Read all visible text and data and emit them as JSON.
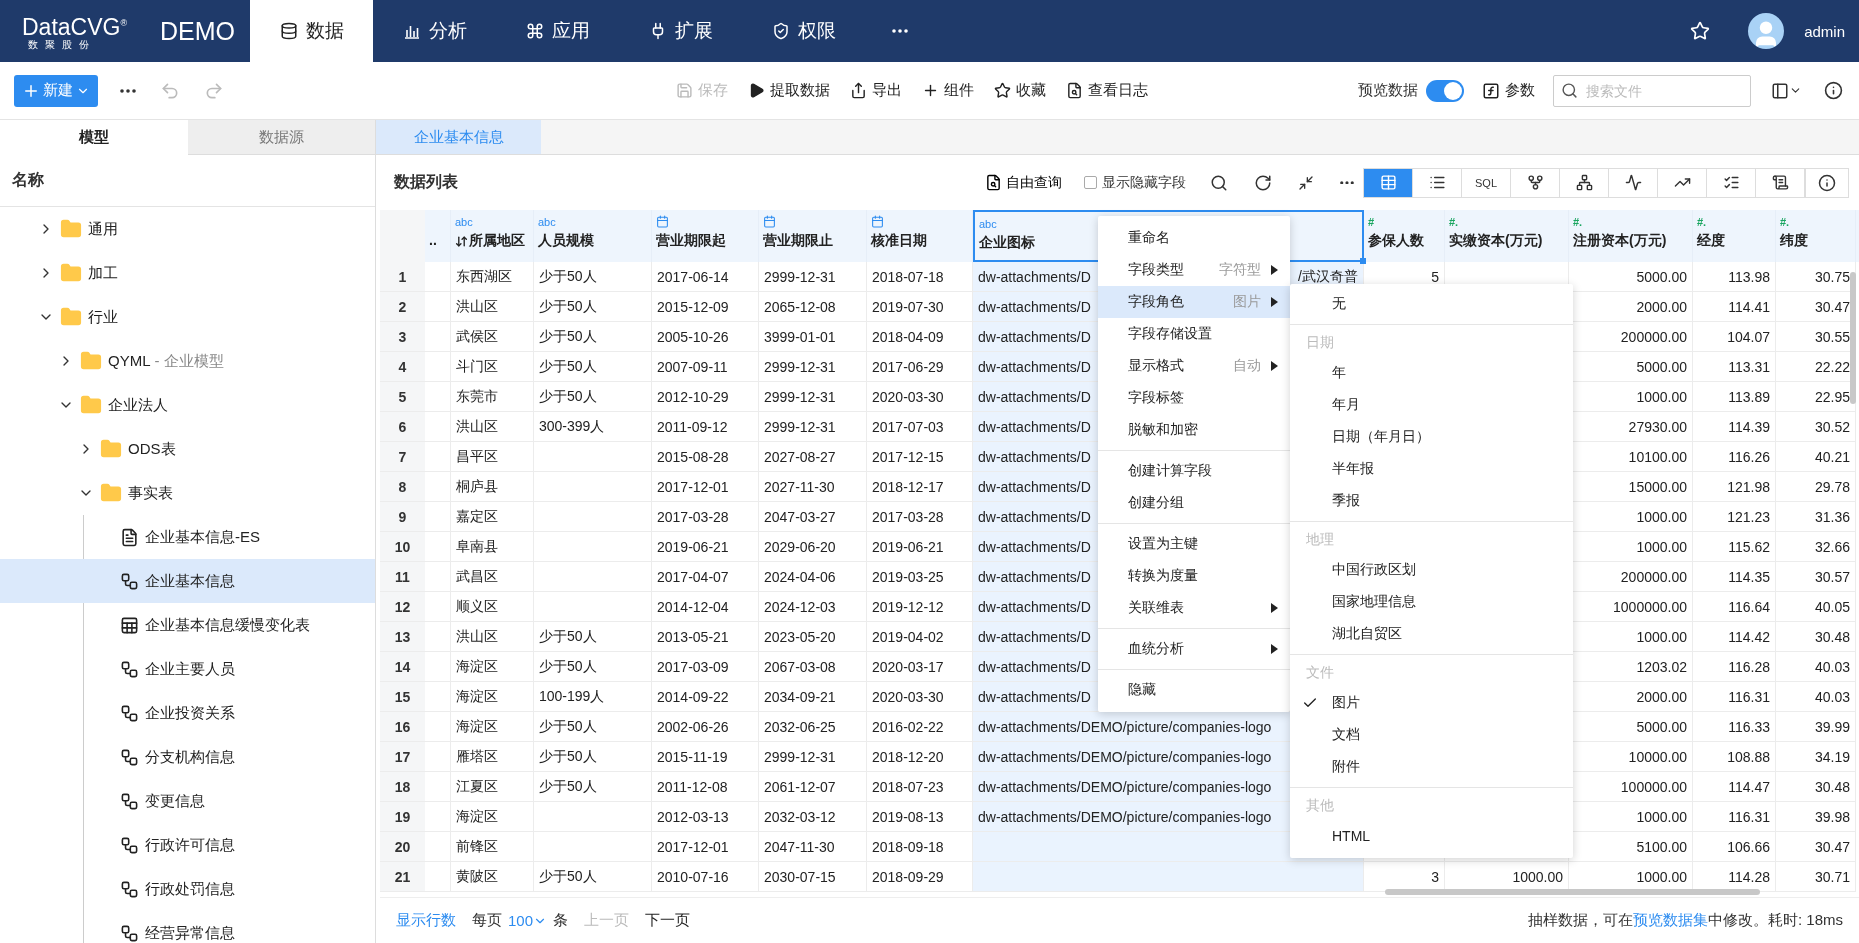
{
  "nav": {
    "logo": "DataCVG",
    "logo_mark": "®",
    "logo_sub": "数聚股份",
    "workspace": "DEMO",
    "tabs": [
      {
        "label": "数据",
        "selected": true
      },
      {
        "label": "分析",
        "selected": false
      },
      {
        "label": "应用",
        "selected": false
      },
      {
        "label": "扩展",
        "selected": false
      },
      {
        "label": "权限",
        "selected": false
      }
    ],
    "user": "admin"
  },
  "toolbar": {
    "new": "新建",
    "actions": [
      {
        "label": "保存",
        "disabled": true
      },
      {
        "label": "提取数据",
        "disabled": false
      },
      {
        "label": "导出",
        "disabled": false
      },
      {
        "label": "组件",
        "disabled": false
      },
      {
        "label": "收藏",
        "disabled": false
      },
      {
        "label": "查看日志",
        "disabled": false
      }
    ],
    "preview": {
      "label": "预览数据",
      "on": true
    },
    "params": "参数",
    "search": {
      "placeholder": "搜索文件"
    }
  },
  "sidebar": {
    "tabs": [
      {
        "label": "模型",
        "selected": true
      },
      {
        "label": "数据源",
        "selected": false
      }
    ],
    "header": "名称",
    "tree": [
      {
        "name": "通用",
        "kind": "folder",
        "expanded": false,
        "selected": false
      },
      {
        "name": "加工",
        "kind": "folder",
        "expanded": false,
        "selected": false
      },
      {
        "name": "行业",
        "kind": "folder",
        "expanded": true,
        "selected": false,
        "children": [
          {
            "name": "QYML",
            "alias": "- 企业模型",
            "kind": "folder",
            "expanded": false,
            "selected": false
          },
          {
            "name": "企业法人",
            "kind": "folder",
            "expanded": true,
            "selected": false,
            "children": [
              {
                "name": "ODS表",
                "kind": "folder",
                "expanded": false,
                "selected": false
              },
              {
                "name": "事实表",
                "kind": "folder",
                "expanded": true,
                "selected": false,
                "children": [
                  {
                    "name": "企业基本信息-ES",
                    "kind": "es",
                    "selected": false
                  },
                  {
                    "name": "企业基本信息",
                    "kind": "model",
                    "selected": true
                  },
                  {
                    "name": "企业基本信息缓慢变化表",
                    "kind": "table",
                    "selected": false
                  },
                  {
                    "name": "企业主要人员",
                    "kind": "model",
                    "selected": false
                  },
                  {
                    "name": "企业投资关系",
                    "kind": "model",
                    "selected": false
                  },
                  {
                    "name": "分支机构信息",
                    "kind": "model",
                    "selected": false
                  },
                  {
                    "name": "变更信息",
                    "kind": "model",
                    "selected": false
                  },
                  {
                    "name": "行政许可信息",
                    "kind": "model",
                    "selected": false
                  },
                  {
                    "name": "行政处罚信息",
                    "kind": "model",
                    "selected": false
                  },
                  {
                    "name": "经营异常信息",
                    "kind": "model",
                    "selected": false
                  }
                ]
              }
            ]
          }
        ]
      }
    ]
  },
  "main": {
    "tabs": [
      {
        "label": "企业基本信息",
        "selected": true
      }
    ],
    "title": "数据列表",
    "query": "自由查询",
    "show_hidden": {
      "label": "显示隐藏字段",
      "checked": false
    },
    "views": [
      {
        "selected": true
      },
      {
        "selected": false
      },
      {
        "label": "SQL",
        "selected": false
      },
      {
        "selected": false
      },
      {
        "selected": false
      },
      {
        "selected": false
      },
      {
        "selected": false
      },
      {
        "selected": false
      },
      {
        "selected": false
      }
    ]
  },
  "table": {
    "columns": [
      {
        "label": "..",
        "kind": "none",
        "selected": false,
        "sorted": false
      },
      {
        "label": "所属地区",
        "kind": "text",
        "tag": "abc",
        "selected": false,
        "sorted": true
      },
      {
        "label": "人员规模",
        "kind": "text",
        "tag": "abc",
        "selected": false,
        "sorted": false
      },
      {
        "label": "营业期限起",
        "kind": "date",
        "selected": false,
        "sorted": false
      },
      {
        "label": "营业期限止",
        "kind": "date",
        "selected": false,
        "sorted": false
      },
      {
        "label": "核准日期",
        "kind": "date",
        "selected": false,
        "sorted": false
      },
      {
        "label": "企业图标",
        "kind": "text",
        "tag": "abc",
        "selected": true,
        "sorted": false
      },
      {
        "label": "参保人数",
        "kind": "number",
        "tag": "#",
        "selected": false,
        "sorted": false
      },
      {
        "label": "实缴资本(万元)",
        "kind": "number",
        "tag": "#.",
        "selected": false,
        "sorted": false
      },
      {
        "label": "注册资本(万元)",
        "kind": "number",
        "tag": "#.",
        "selected": false,
        "sorted": false
      },
      {
        "label": "经度",
        "kind": "number",
        "tag": "#.",
        "selected": false,
        "sorted": false
      },
      {
        "label": "纬度",
        "kind": "number",
        "tag": "#.",
        "selected": false,
        "sorted": false
      }
    ],
    "rows": [
      {
        "no": "1",
        "cells": [
          null,
          "东西湖区",
          "少于50人",
          "2017-06-14",
          "2999-12-31",
          "2018-07-18",
          "dw-attachments/D",
          "5",
          null,
          "5000.00",
          "113.98",
          "30.75"
        ],
        "overflow": "/武汉奇普"
      },
      {
        "no": "2",
        "cells": [
          null,
          "洪山区",
          "少于50人",
          "2015-12-09",
          "2065-12-08",
          "2019-07-30",
          "dw-attachments/D",
          null,
          null,
          "2000.00",
          "114.41",
          "30.47"
        ]
      },
      {
        "no": "3",
        "cells": [
          null,
          "武侯区",
          "少于50人",
          "2005-10-26",
          "3999-01-01",
          "2018-04-09",
          "dw-attachments/D",
          null,
          null,
          "200000.00",
          "104.07",
          "30.55"
        ]
      },
      {
        "no": "4",
        "cells": [
          null,
          "斗门区",
          "少于50人",
          "2007-09-11",
          "2999-12-31",
          "2017-06-29",
          "dw-attachments/D",
          null,
          null,
          "5000.00",
          "113.31",
          "22.22"
        ]
      },
      {
        "no": "5",
        "cells": [
          null,
          "东莞市",
          "少于50人",
          "2012-10-29",
          "2999-12-31",
          "2020-03-30",
          "dw-attachments/D",
          null,
          null,
          "1000.00",
          "113.89",
          "22.95"
        ]
      },
      {
        "no": "6",
        "cells": [
          null,
          "洪山区",
          "300-399人",
          "2011-09-12",
          "2999-12-31",
          "2017-07-03",
          "dw-attachments/D",
          null,
          null,
          "27930.00",
          "114.39",
          "30.52"
        ]
      },
      {
        "no": "7",
        "cells": [
          null,
          "昌平区",
          null,
          "2015-08-28",
          "2027-08-27",
          "2017-12-15",
          "dw-attachments/D",
          null,
          null,
          "10100.00",
          "116.26",
          "40.21"
        ]
      },
      {
        "no": "8",
        "cells": [
          null,
          "桐庐县",
          null,
          "2017-12-01",
          "2027-11-30",
          "2018-12-17",
          "dw-attachments/D",
          null,
          null,
          "15000.00",
          "121.98",
          "29.78"
        ]
      },
      {
        "no": "9",
        "cells": [
          null,
          "嘉定区",
          null,
          "2017-03-28",
          "2047-03-27",
          "2017-03-28",
          "dw-attachments/D",
          null,
          null,
          "1000.00",
          "121.23",
          "31.36"
        ]
      },
      {
        "no": "10",
        "cells": [
          null,
          "阜南县",
          null,
          "2019-06-21",
          "2029-06-20",
          "2019-06-21",
          "dw-attachments/D",
          null,
          null,
          "1000.00",
          "115.62",
          "32.66"
        ]
      },
      {
        "no": "11",
        "cells": [
          null,
          "武昌区",
          null,
          "2017-04-07",
          "2024-04-06",
          "2019-03-25",
          "dw-attachments/D",
          null,
          null,
          "200000.00",
          "114.35",
          "30.57"
        ]
      },
      {
        "no": "12",
        "cells": [
          null,
          "顺义区",
          null,
          "2014-12-04",
          "2024-12-03",
          "2019-12-12",
          "dw-attachments/D",
          null,
          null,
          "1000000.00",
          "116.64",
          "40.05"
        ]
      },
      {
        "no": "13",
        "cells": [
          null,
          "洪山区",
          "少于50人",
          "2013-05-21",
          "2023-05-20",
          "2019-04-02",
          "dw-attachments/D",
          null,
          null,
          "1000.00",
          "114.42",
          "30.48"
        ]
      },
      {
        "no": "14",
        "cells": [
          null,
          "海淀区",
          "少于50人",
          "2017-03-09",
          "2067-03-08",
          "2020-03-17",
          "dw-attachments/D",
          null,
          null,
          "1203.02",
          "116.28",
          "40.03"
        ]
      },
      {
        "no": "15",
        "cells": [
          null,
          "海淀区",
          "100-199人",
          "2014-09-22",
          "2034-09-21",
          "2020-03-30",
          "dw-attachments/D",
          null,
          null,
          "2000.00",
          "116.31",
          "40.03"
        ]
      },
      {
        "no": "16",
        "cells": [
          null,
          "海淀区",
          "少于50人",
          "2002-06-26",
          "2032-06-25",
          "2016-02-22",
          "dw-attachments/DEMO/picture/companies-logo",
          null,
          null,
          "5000.00",
          "116.33",
          "39.99"
        ]
      },
      {
        "no": "17",
        "cells": [
          null,
          "雁塔区",
          "少于50人",
          "2015-11-19",
          "2999-12-31",
          "2018-12-20",
          "dw-attachments/DEMO/picture/companies-logo",
          null,
          null,
          "10000.00",
          "108.88",
          "34.19"
        ]
      },
      {
        "no": "18",
        "cells": [
          null,
          "江夏区",
          "少于50人",
          "2011-12-08",
          "2061-12-07",
          "2018-07-23",
          "dw-attachments/DEMO/picture/companies-logo",
          null,
          null,
          "100000.00",
          "114.47",
          "30.48"
        ]
      },
      {
        "no": "19",
        "cells": [
          null,
          "海淀区",
          null,
          "2012-03-13",
          "2032-03-12",
          "2019-08-13",
          "dw-attachments/DEMO/picture/companies-logo",
          null,
          null,
          "1000.00",
          "116.31",
          "39.98"
        ]
      },
      {
        "no": "20",
        "cells": [
          null,
          "前锋区",
          null,
          "2017-12-01",
          "2047-11-30",
          "2018-09-18",
          null,
          null,
          null,
          "5100.00",
          "106.66",
          "30.47"
        ]
      },
      {
        "no": "21",
        "cells": [
          null,
          "黄陂区",
          "少于50人",
          "2010-07-16",
          "2030-07-15",
          "2018-09-29",
          null,
          "3",
          "1000.00",
          "1000.00",
          "114.28",
          "30.71"
        ]
      }
    ]
  },
  "footer": {
    "rows_link": "显示行数",
    "per_page": "每页",
    "page_size": "100",
    "unit": "条",
    "prev": {
      "label": "上一页",
      "disabled": true
    },
    "next": {
      "label": "下一页",
      "disabled": false
    },
    "note": {
      "before": "抽样数据，可在",
      "link": "预览数据集",
      "after": "中修改。耗时: 18ms"
    }
  },
  "menu": {
    "groups": [
      [
        {
          "label": "重命名",
          "submenu": false,
          "highlighted": false
        },
        {
          "label": "字段类型",
          "value": "字符型",
          "submenu": true,
          "highlighted": false
        },
        {
          "label": "字段角色",
          "value": "图片",
          "submenu": true,
          "highlighted": true
        },
        {
          "label": "字段存储设置",
          "submenu": false,
          "highlighted": false
        },
        {
          "label": "显示格式",
          "value": "自动",
          "submenu": true,
          "highlighted": false
        },
        {
          "label": "字段标签",
          "submenu": false,
          "highlighted": false
        },
        {
          "label": "脱敏和加密",
          "submenu": false,
          "highlighted": false
        }
      ],
      [
        {
          "label": "创建计算字段",
          "submenu": false,
          "highlighted": false
        },
        {
          "label": "创建分组",
          "submenu": false,
          "highlighted": false
        }
      ],
      [
        {
          "label": "设置为主键",
          "submenu": false,
          "highlighted": false
        },
        {
          "label": "转换为度量",
          "submenu": false,
          "highlighted": false
        },
        {
          "label": "关联维表",
          "submenu": true,
          "highlighted": false
        }
      ],
      [
        {
          "label": "血统分析",
          "submenu": true,
          "highlighted": false
        }
      ],
      [
        {
          "label": "隐藏",
          "submenu": false,
          "highlighted": false
        }
      ]
    ]
  },
  "submenu": {
    "sections": [
      {
        "items": [
          {
            "label": "无",
            "checked": false
          }
        ]
      },
      {
        "title": "日期",
        "items": [
          {
            "label": "年",
            "checked": false
          },
          {
            "label": "年月",
            "checked": false
          },
          {
            "label": "日期（年月日）",
            "checked": false
          },
          {
            "label": "半年报",
            "checked": false
          },
          {
            "label": "季报",
            "checked": false
          }
        ]
      },
      {
        "title": "地理",
        "items": [
          {
            "label": "中国行政区划",
            "checked": false
          },
          {
            "label": "国家地理信息",
            "checked": false
          },
          {
            "label": "湖北自贸区",
            "checked": false
          }
        ]
      },
      {
        "title": "文件",
        "items": [
          {
            "label": "图片",
            "checked": true
          },
          {
            "label": "文档",
            "checked": false
          },
          {
            "label": "附件",
            "checked": false
          }
        ]
      },
      {
        "title": "其他",
        "items": [
          {
            "label": "HTML",
            "checked": false
          }
        ]
      }
    ]
  }
}
